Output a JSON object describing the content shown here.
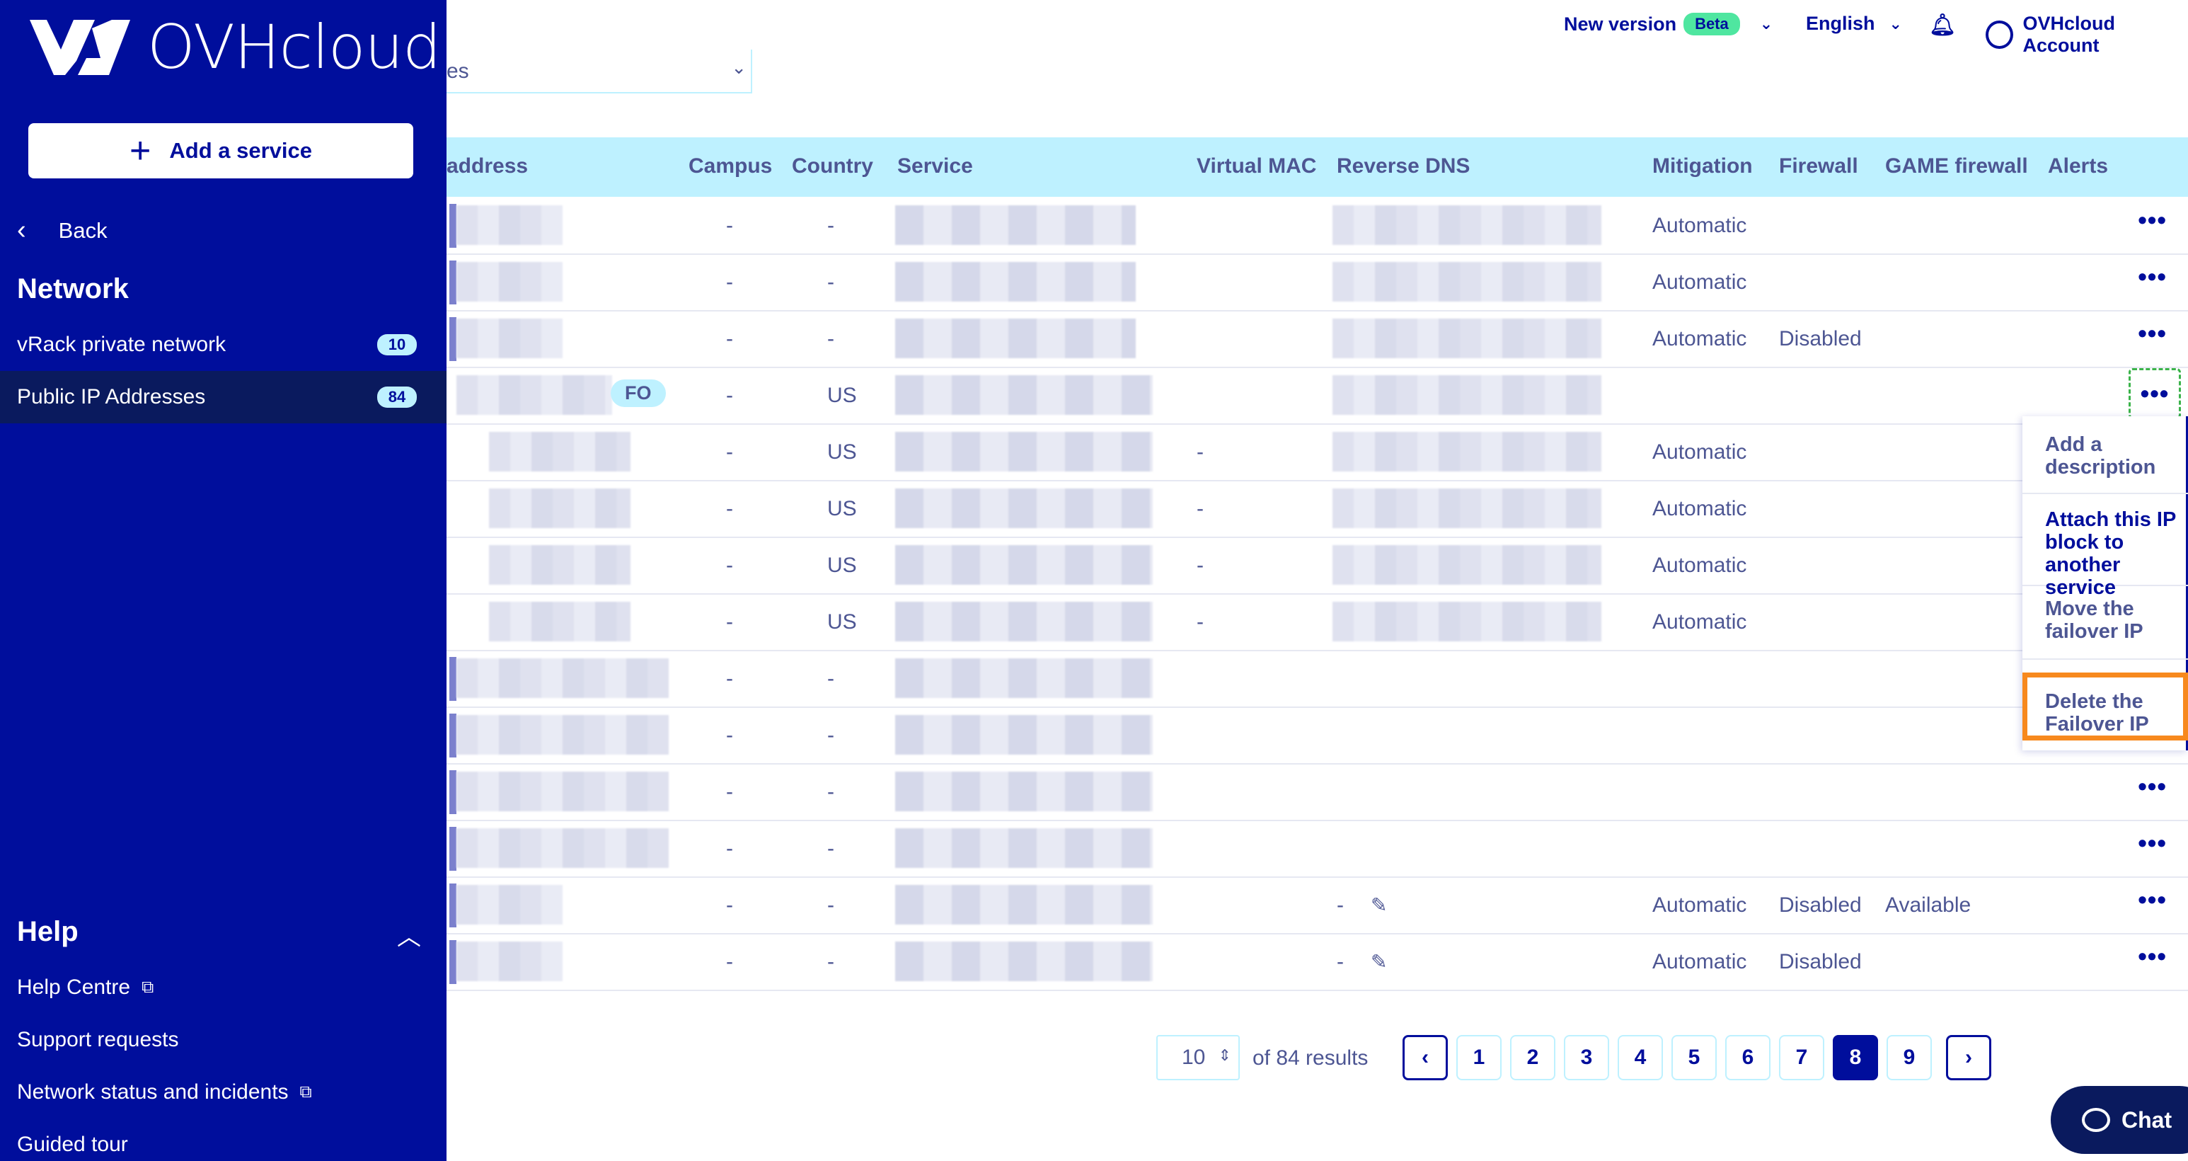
{
  "brand": {
    "name": "OVHcloud"
  },
  "sidebar": {
    "add_service": "Add a service",
    "back": "Back",
    "network_title": "Network",
    "items": [
      {
        "label": "vRack private network",
        "count": "10"
      },
      {
        "label": "Public IP Addresses",
        "count": "84"
      }
    ],
    "help_title": "Help",
    "help_links": [
      {
        "label": "Help Centre"
      },
      {
        "label": "Support requests"
      },
      {
        "label": "Network status and incidents"
      },
      {
        "label": "Guided tour"
      }
    ]
  },
  "topbar": {
    "new_version": "New version",
    "beta": "Beta",
    "language": "English",
    "account": "OVHcloud Account"
  },
  "filter": {
    "value": "es"
  },
  "table": {
    "headers": [
      "address",
      "Campus",
      "Country",
      "Service",
      "Virtual MAC",
      "Reverse DNS",
      "Mitigation",
      "Firewall",
      "GAME firewall",
      "Alerts"
    ],
    "rows": [
      {
        "campus": "-",
        "country": "-",
        "vmac": "",
        "mitigation": "Automatic",
        "firewall": "",
        "game": ""
      },
      {
        "campus": "-",
        "country": "-",
        "vmac": "",
        "mitigation": "Automatic",
        "firewall": "",
        "game": ""
      },
      {
        "campus": "-",
        "country": "-",
        "vmac": "",
        "mitigation": "Automatic",
        "firewall": "Disabled",
        "game": ""
      },
      {
        "campus": "-",
        "country": "US",
        "vmac": "",
        "mitigation": "",
        "firewall": "",
        "game": "",
        "tag": "FO"
      },
      {
        "campus": "-",
        "country": "US",
        "vmac": "-",
        "mitigation": "Automatic",
        "firewall": "",
        "game": ""
      },
      {
        "campus": "-",
        "country": "US",
        "vmac": "-",
        "mitigation": "Automatic",
        "firewall": "",
        "game": ""
      },
      {
        "campus": "-",
        "country": "US",
        "vmac": "-",
        "mitigation": "Automatic",
        "firewall": "",
        "game": ""
      },
      {
        "campus": "-",
        "country": "US",
        "vmac": "-",
        "mitigation": "Automatic",
        "firewall": "",
        "game": ""
      },
      {
        "campus": "-",
        "country": "-",
        "vmac": "",
        "mitigation": "",
        "firewall": "",
        "game": ""
      },
      {
        "campus": "-",
        "country": "-",
        "vmac": "",
        "mitigation": "",
        "firewall": "",
        "game": ""
      },
      {
        "campus": "-",
        "country": "-",
        "vmac": "",
        "mitigation": "",
        "firewall": "",
        "game": ""
      },
      {
        "campus": "-",
        "country": "-",
        "vmac": "",
        "mitigation": "",
        "firewall": "",
        "game": ""
      },
      {
        "campus": "-",
        "country": "-",
        "vmac": "",
        "rdns": "-",
        "mitigation": "Automatic",
        "firewall": "Disabled",
        "game": "Available"
      },
      {
        "campus": "-",
        "country": "-",
        "vmac": "",
        "rdns": "-",
        "mitigation": "Automatic",
        "firewall": "Disabled",
        "game": ""
      }
    ]
  },
  "menu": {
    "items": [
      "Add a description",
      "Attach this IP block to another service",
      "Move the failover IP",
      "Delete the Failover IP"
    ]
  },
  "pagination": {
    "per_page": "10",
    "results_text": "of 84 results",
    "pages": [
      "1",
      "2",
      "3",
      "4",
      "5",
      "6",
      "7",
      "8",
      "9"
    ],
    "current": "8"
  },
  "chat": {
    "label": "Chat"
  },
  "colors": {
    "brand": "#000e9c",
    "accent_header": "#bef1ff",
    "highlight": "#f7891e",
    "focus": "#3bb34a"
  }
}
